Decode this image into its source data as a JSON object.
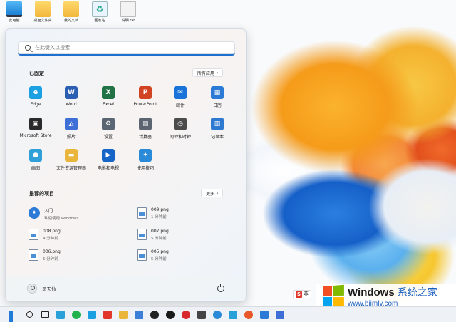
{
  "desktop": {
    "icons": [
      {
        "label": "此电脑",
        "kind": "monitor"
      },
      {
        "label": "桌面文件夹",
        "kind": "folder"
      },
      {
        "label": "我的文档",
        "kind": "folder"
      },
      {
        "label": "回收站",
        "kind": "recycle"
      },
      {
        "label": "说明.txt",
        "kind": "doc"
      }
    ]
  },
  "start_menu": {
    "search_placeholder": "在此键入以搜索",
    "pinned_title": "已固定",
    "all_apps_label": "所有应用",
    "pinned_apps": [
      {
        "label": "Edge",
        "icon": "edge-icon",
        "color": "#1ba1e2"
      },
      {
        "label": "Word",
        "icon": "word-icon",
        "color": "#2b5fb4"
      },
      {
        "label": "Excel",
        "icon": "excel-icon",
        "color": "#217346"
      },
      {
        "label": "PowerPoint",
        "icon": "powerpoint-icon",
        "color": "#d04423"
      },
      {
        "label": "邮件",
        "icon": "mail-icon",
        "color": "#1a73d9"
      },
      {
        "label": "日历",
        "icon": "calendar-icon",
        "color": "#2a7ad6"
      },
      {
        "label": "Microsoft Store",
        "icon": "store-icon",
        "color": "#2a2a2a"
      },
      {
        "label": "照片",
        "icon": "photos-icon",
        "color": "#3d6fd6"
      },
      {
        "label": "设置",
        "icon": "gear-icon",
        "color": "#5a6573"
      },
      {
        "label": "计算器",
        "icon": "calculator-icon",
        "color": "#5b6470"
      },
      {
        "label": "闹钟和时钟",
        "icon": "clock-icon",
        "color": "#4c4c4c"
      },
      {
        "label": "记事本",
        "icon": "notepad-icon",
        "color": "#2e7ad0"
      },
      {
        "label": "画图",
        "icon": "paint-icon",
        "color": "#2fa0d8"
      },
      {
        "label": "文件资源管理器",
        "icon": "folder-icon",
        "color": "#e9b53a"
      },
      {
        "label": "电影和电视",
        "icon": "movies-icon",
        "color": "#1766c7"
      },
      {
        "label": "使用技巧",
        "icon": "tips-icon",
        "color": "#2a8ad8"
      }
    ],
    "recommended_title": "推荐的项目",
    "more_label": "更多",
    "recommended": [
      {
        "title": "入门",
        "subtitle": "欢迎使用 Windows",
        "icon": "getstarted-icon"
      },
      {
        "title": "009.png",
        "subtitle": "1 分钟前",
        "icon": "file-icon"
      },
      {
        "title": "008.png",
        "subtitle": "4 分钟前",
        "icon": "file-icon"
      },
      {
        "title": "007.png",
        "subtitle": "5 分钟前",
        "icon": "file-icon"
      },
      {
        "title": "006.png",
        "subtitle": "5 分钟前",
        "icon": "file-icon"
      },
      {
        "title": "005.png",
        "subtitle": "5 分钟前",
        "icon": "file-icon"
      }
    ],
    "user_name": "灵天仙"
  },
  "ime": {
    "label": "英"
  },
  "watermark": {
    "line1_a": "Windows",
    "line1_b": "系统之家",
    "line2": "www.bjjmlv.com"
  },
  "taskbar": {
    "items": [
      {
        "icon": "start-icon"
      },
      {
        "icon": "search-icon"
      },
      {
        "icon": "task-view-icon"
      },
      {
        "icon": "widgets-icon",
        "color": "#2aa0d8"
      },
      {
        "icon": "wechat-icon",
        "color": "#22b24c"
      },
      {
        "icon": "edge-icon",
        "color": "#1ba1e2"
      },
      {
        "icon": "browser-icon",
        "color": "#e2362b"
      },
      {
        "icon": "file-explorer-icon",
        "color": "#e9b53a"
      },
      {
        "icon": "app-icon",
        "color": "#3b7fd8"
      },
      {
        "icon": "qq-icon",
        "color": "#222"
      },
      {
        "icon": "penguin-icon",
        "color": "#1a1a1a"
      },
      {
        "icon": "netease-music-icon",
        "color": "#d9272e"
      },
      {
        "icon": "media-icon",
        "color": "#444"
      },
      {
        "icon": "tips-icon",
        "color": "#2a8ad8"
      },
      {
        "icon": "audio-icon",
        "color": "#2aa0d8"
      },
      {
        "icon": "weibo-icon",
        "color": "#e8572a"
      },
      {
        "icon": "app2-icon",
        "color": "#2a7ad6"
      },
      {
        "icon": "photo-icon",
        "color": "#3d6fd6"
      }
    ]
  },
  "colors": {
    "accent": "#1f6fd0"
  }
}
